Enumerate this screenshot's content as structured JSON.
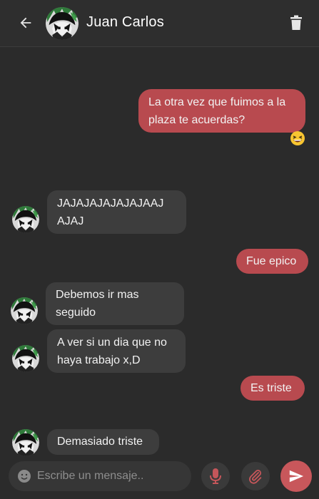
{
  "header": {
    "contact_name": "Juan Carlos",
    "back_icon": "arrow-left-icon",
    "delete_icon": "trash-icon"
  },
  "messages": [
    {
      "direction": "outgoing",
      "text": "La otra vez que fuimos a la\nplaza te acuerdas?"
    },
    {
      "direction": "incoming",
      "text": "JAJAJAJAJAJAJAAJ\nAJAJ"
    },
    {
      "direction": "outgoing",
      "text": "Fue epico"
    },
    {
      "direction": "incoming",
      "text": "Debemos ir mas\nseguido"
    },
    {
      "direction": "incoming",
      "text": "A ver si un dia que no\nhaya trabajo x,D"
    },
    {
      "direction": "outgoing",
      "text": "Es triste"
    },
    {
      "direction": "incoming",
      "text": "Demasiado triste"
    }
  ],
  "reaction": {
    "emoji": "😆",
    "icon": "grinning-squinting-face-icon"
  },
  "composer": {
    "placeholder": "Escribe un mensaje..",
    "value": ""
  },
  "colors": {
    "background": "#2b2b2b",
    "incoming_bubble": "#3d3d3d",
    "outgoing_bubble": "#b84a4f",
    "send_button": "#c8575b",
    "icon_red": "#c4565a"
  }
}
